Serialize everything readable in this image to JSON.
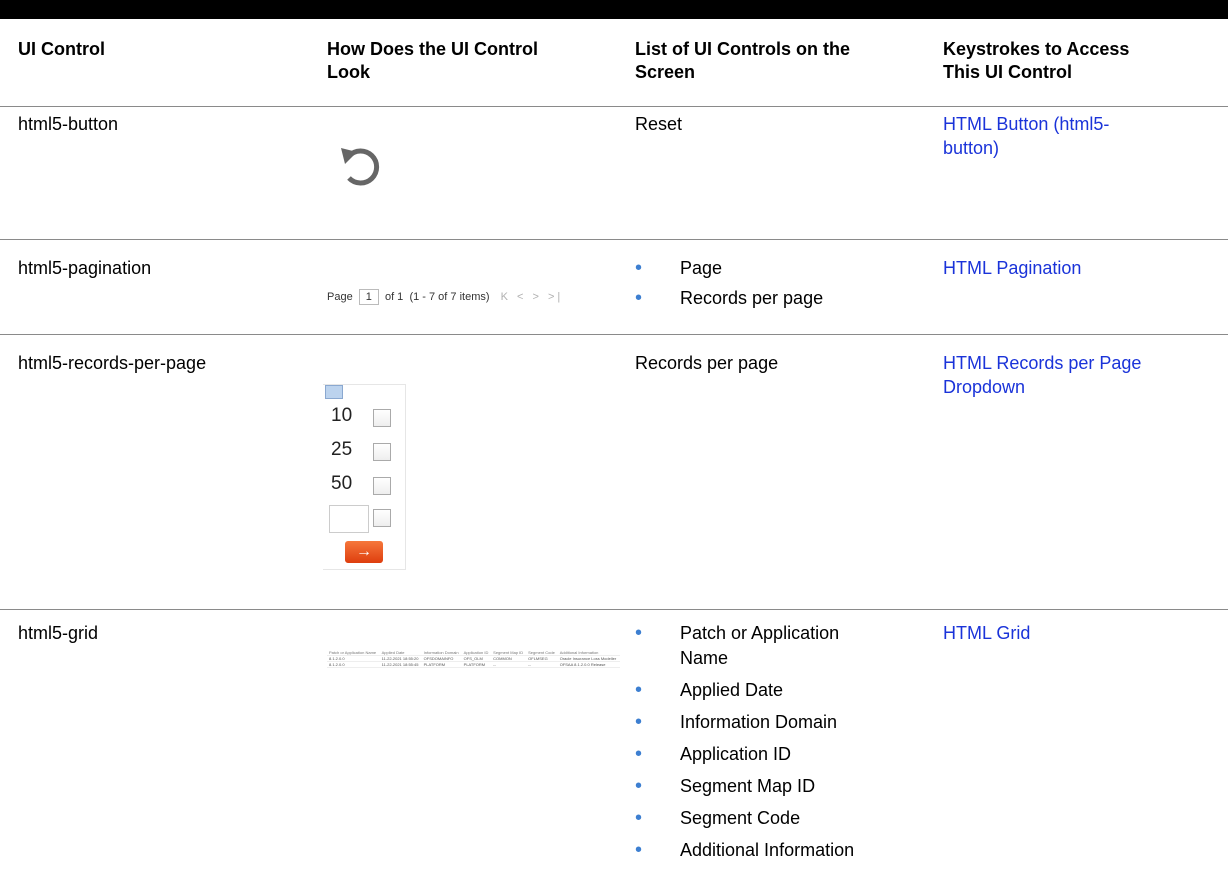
{
  "table": {
    "headers": {
      "col1": "UI Control",
      "col2_l1": "How Does the UI Control",
      "col2_l2": "Look",
      "col3_l1": "List of UI Controls on the",
      "col3_l2": "Screen",
      "col4_l1": "Keystrokes to Access",
      "col4_l2": "This UI Control"
    },
    "rows": [
      {
        "control": "html5-button",
        "controls_list": "Reset",
        "link_l1": "HTML Button (html5-",
        "link_l2": "button)",
        "icon": "reset-icon"
      },
      {
        "control": "html5-pagination",
        "bullets": [
          "Page",
          "Records per page"
        ],
        "link_l1": "HTML Pagination"
      },
      {
        "control": "html5-records-per-page",
        "controls_list": "Records per page",
        "link_l1": "HTML Records per Page",
        "link_l2": "Dropdown"
      },
      {
        "control": "html5-grid",
        "bullets": [
          "Patch or Application",
          "Name",
          "Applied Date",
          "Information Domain",
          "Application ID",
          "Segment Map ID",
          "Segment Code",
          "Additional Information"
        ],
        "link_l1": "HTML Grid"
      }
    ]
  },
  "pagination_sample": {
    "page_label": "Page",
    "page_value": "1",
    "of_label": "of 1",
    "range": "(1 - 7 of",
    "total": "7",
    "items_label": "items)",
    "nav": "K < > >|"
  },
  "rpp_sample": {
    "options": [
      "10",
      "25",
      "50"
    ],
    "go_symbol": "→"
  },
  "grid_sample": {
    "headers": [
      "Patch or Application Name",
      "Applied Date",
      "Information Domain",
      "Application ID",
      "Segment Map ID",
      "Segment Code",
      "Additional Information"
    ],
    "rows": [
      [
        "8.1.2.0.0",
        "11-22-2021 18:55:20",
        "OFSDOMAINFO",
        "OFS_OLM",
        "COMMON",
        "OFLMSEG",
        "Oracle Insurance Loss Modeller"
      ],
      [
        "8.1.2.0.0",
        "11-22-2021 18:55:45",
        "PLATFORM",
        "PLATFORM",
        "--",
        "--",
        "OFSAA 8.1.2.0.0 Release"
      ]
    ]
  }
}
